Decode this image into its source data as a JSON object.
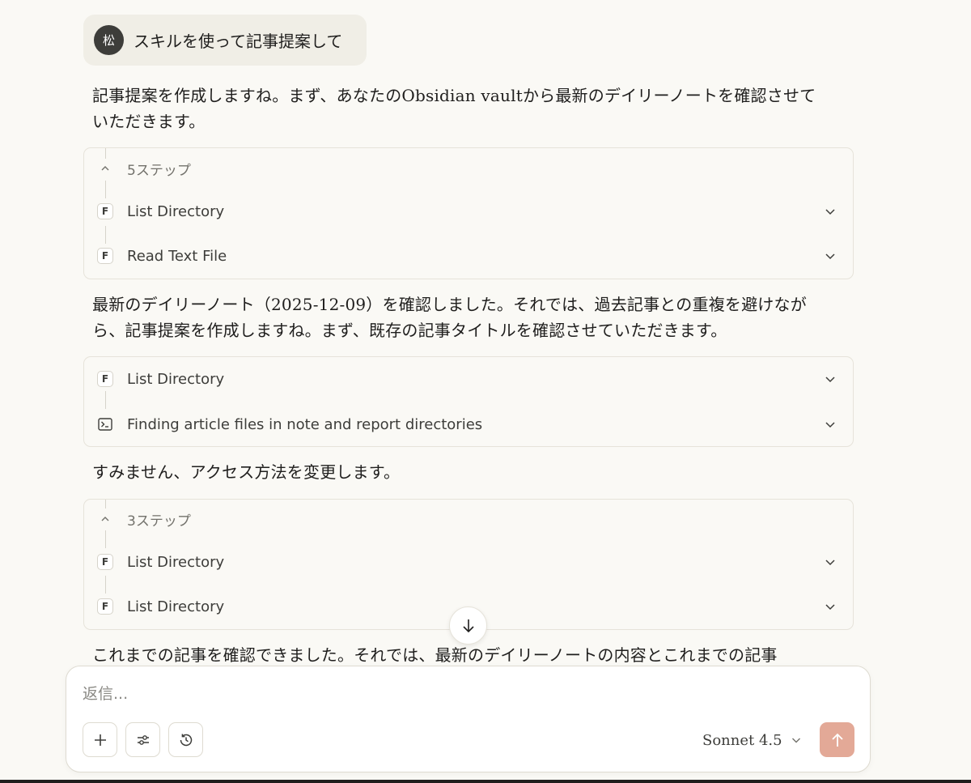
{
  "user_message": {
    "avatar_initial": "松",
    "text": "スキルを使って記事提案して"
  },
  "assistant": {
    "paragraphs": [
      "記事提案を作成しますね。まず、あなたのObsidian vaultから最新のデイリーノートを確認させていただきます。",
      "最新のデイリーノート（2025-12-09）を確認しました。それでは、過去記事との重複を避けながら、記事提案を作成しますね。まず、既存の記事タイトルを確認させていただきます。",
      "すみません、アクセス方法を変更します。",
      "これまでの記事を確認できました。それでは、最新のデイリーノートの内容とこれまでの記事"
    ]
  },
  "tool_groups": [
    {
      "steps_label": "5ステップ",
      "items": [
        {
          "icon": "F",
          "label": "List Directory"
        },
        {
          "icon": "F",
          "label": "Read Text File"
        }
      ]
    },
    {
      "steps_label": "",
      "items": [
        {
          "icon": "F",
          "label": "List Directory"
        },
        {
          "icon": "terminal-icon",
          "label": "Finding article files in note and report directories"
        }
      ]
    },
    {
      "steps_label": "3ステップ",
      "items": [
        {
          "icon": "F",
          "label": "List Directory"
        },
        {
          "icon": "F",
          "label": "List Directory"
        }
      ]
    }
  ],
  "composer": {
    "placeholder": "返信...",
    "model": "Sonnet 4.5",
    "buttons": [
      "plus-icon",
      "sliders-icon",
      "history-clock-icon"
    ]
  },
  "colors": {
    "background": "#faf9f5",
    "user_bubble": "#f0eee6",
    "send_button": "#e3a997",
    "border": "#e6e3da"
  }
}
